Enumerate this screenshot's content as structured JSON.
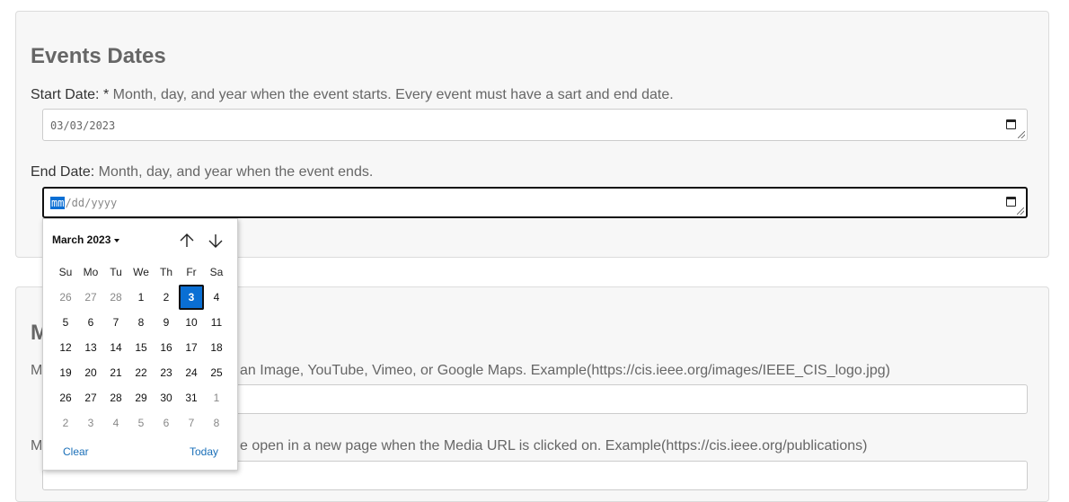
{
  "events_dates": {
    "title": "Events Dates",
    "start_date": {
      "label": "Start Date:",
      "required_marker": "*",
      "help": "Month, day, and year when the event starts. Every event must have a sart and end date.",
      "value": "03/03/2023"
    },
    "end_date": {
      "label": "End Date:",
      "help": "Month, day, and year when the event ends.",
      "segment_mm": "mm",
      "rest": "/dd/yyyy"
    }
  },
  "media": {
    "title_partial": "M",
    "media_url": {
      "label_partial": "M",
      "help_visible": "an Image, YouTube, Vimeo, or Google Maps. Example(https://cis.ieee.org/images/IEEE_CIS_logo.jpg)"
    },
    "link_url": {
      "label_partial": "M",
      "help_visible": "e open in a new page when the Media URL is clicked on. Example(https://cis.ieee.org/publications)"
    }
  },
  "calendar": {
    "month_label": "March 2023",
    "weekdays": [
      "Su",
      "Mo",
      "Tu",
      "We",
      "Th",
      "Fr",
      "Sa"
    ],
    "weeks": [
      [
        "26",
        "27",
        "28",
        "1",
        "2",
        "3",
        "4"
      ],
      [
        "5",
        "6",
        "7",
        "8",
        "9",
        "10",
        "11"
      ],
      [
        "12",
        "13",
        "14",
        "15",
        "16",
        "17",
        "18"
      ],
      [
        "19",
        "20",
        "21",
        "22",
        "23",
        "24",
        "25"
      ],
      [
        "26",
        "27",
        "28",
        "29",
        "30",
        "31",
        "1"
      ],
      [
        "2",
        "3",
        "4",
        "5",
        "6",
        "7",
        "8"
      ]
    ],
    "selected_day": "3",
    "clear_label": "Clear",
    "today_label": "Today",
    "accent_color": "#0a6fd4",
    "link_color": "#1a6fb8"
  }
}
